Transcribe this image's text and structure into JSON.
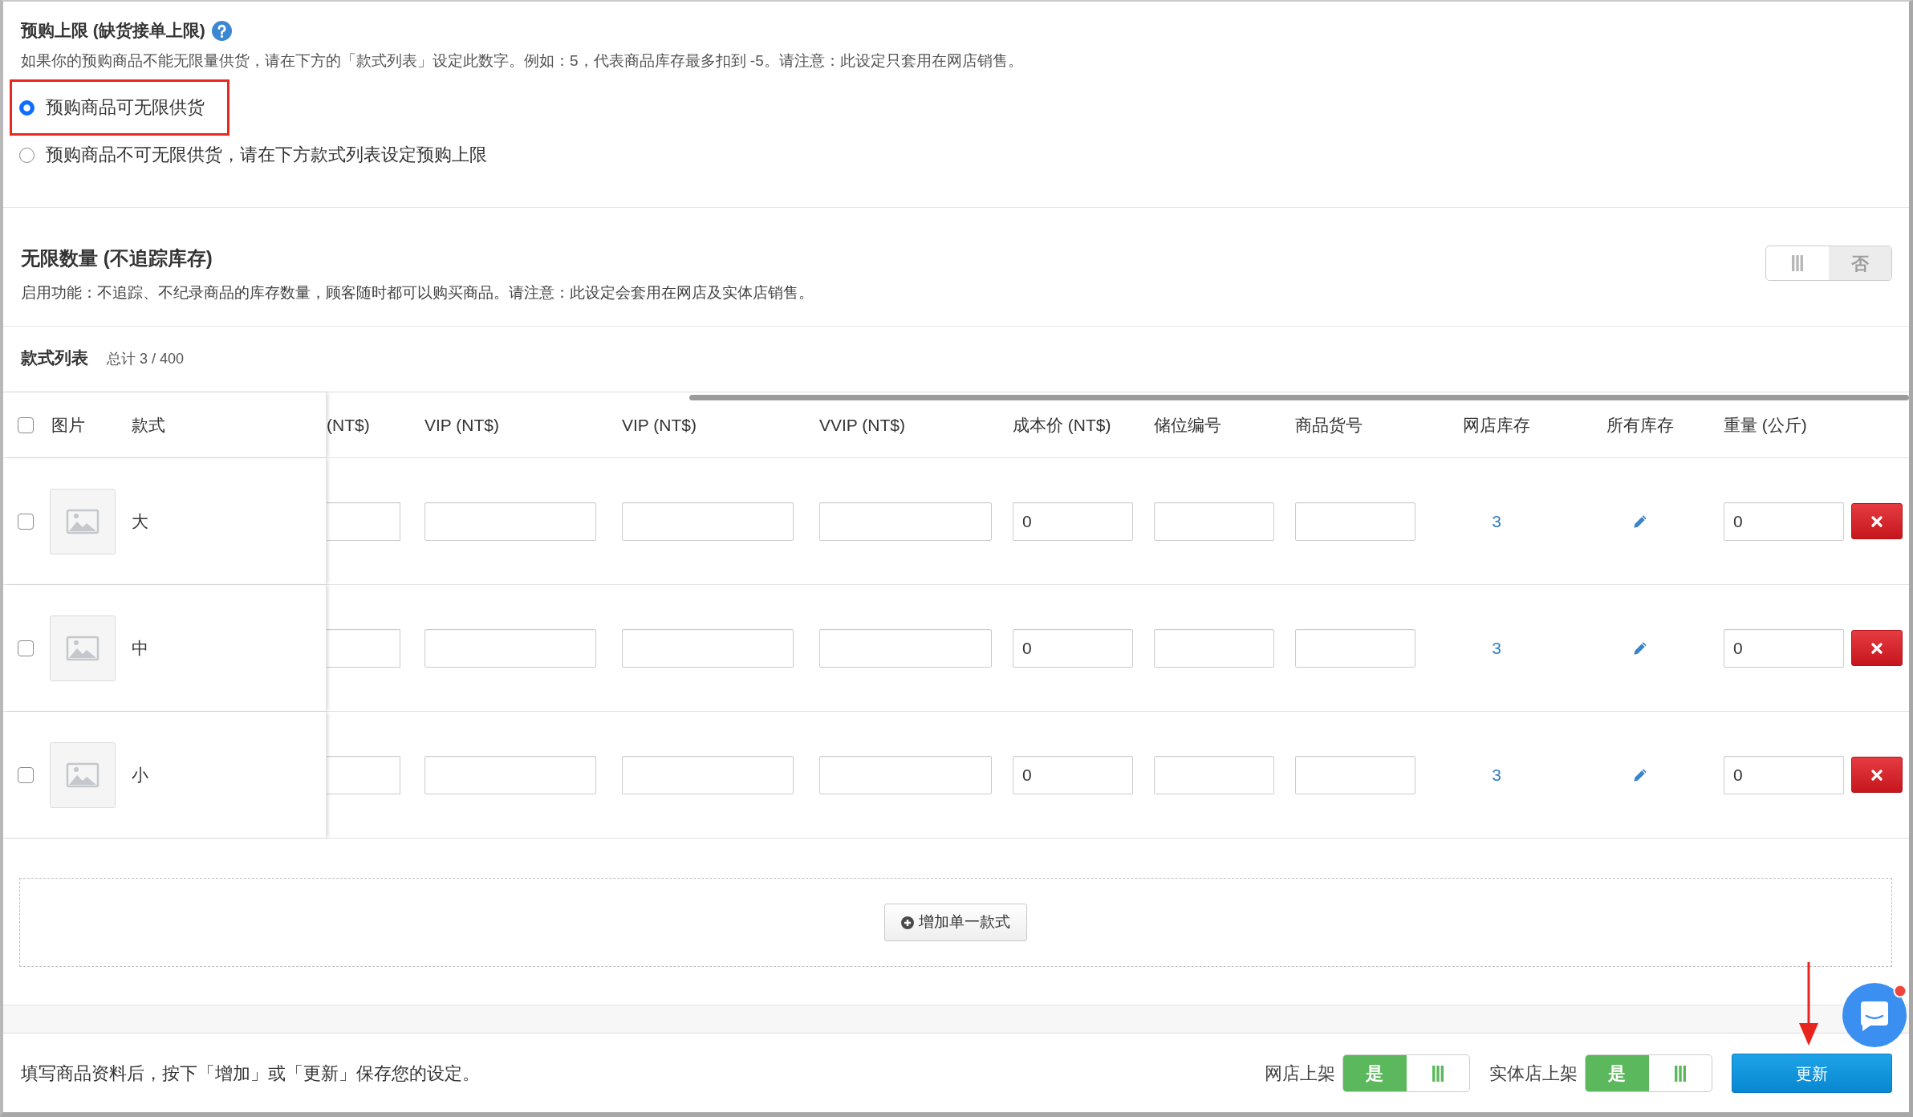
{
  "preorder_limit": {
    "title": "预购上限 (缺货接单上限)",
    "description": "如果你的预购商品不能无限量供货，请在下方的「款式列表」设定此数字。例如：5，代表商品库存最多扣到 -5。请注意：此设定只套用在网店销售。",
    "options": [
      {
        "label": "预购商品可无限供货",
        "selected": true,
        "highlighted": true
      },
      {
        "label": "预购商品不可无限供货，请在下方款式列表设定预购上限",
        "selected": false,
        "highlighted": false
      }
    ]
  },
  "unlimited_quantity": {
    "title": "无限数量 (不追踪库存)",
    "description": "启用功能：不追踪、不纪录商品的库存数量，顾客随时都可以购买商品。请注意：此设定会套用在网店及实体店销售。",
    "toggle": {
      "on": false,
      "value": "否"
    }
  },
  "variants": {
    "title": "款式列表",
    "count": "总计 3 / 400",
    "select_all": {
      "checked": false
    },
    "columns": [
      {
        "label": "图片",
        "kind": "image"
      },
      {
        "label": "款式",
        "kind": "name"
      },
      {
        "label": "(NT$)",
        "kind": "price"
      },
      {
        "label": "VIP (NT$)",
        "kind": "price"
      },
      {
        "label": "VIP (NT$)",
        "kind": "price"
      },
      {
        "label": "VVIP (NT$)",
        "kind": "price"
      },
      {
        "label": "成本价 (NT$)",
        "kind": "cost"
      },
      {
        "label": "储位编号",
        "kind": "location"
      },
      {
        "label": "商品货号",
        "kind": "sku"
      },
      {
        "label": "网店库存",
        "kind": "online_stock"
      },
      {
        "label": "所有库存",
        "kind": "all_stock"
      },
      {
        "label": "重量 (公斤)",
        "kind": "weight"
      }
    ],
    "rows": [
      {
        "checked": false,
        "name": "大",
        "cost": "0",
        "online_stock": "3",
        "weight": "0"
      },
      {
        "checked": false,
        "name": "中",
        "cost": "0",
        "online_stock": "3",
        "weight": "0"
      },
      {
        "checked": false,
        "name": "小",
        "cost": "0",
        "online_stock": "3",
        "weight": "0"
      }
    ],
    "add_button": "增加单一款式"
  },
  "footer": {
    "note": "填写商品资料后，按下「增加」或「更新」保存您的设定。",
    "switches": [
      {
        "label": "网店上架",
        "on": true,
        "value": "是"
      },
      {
        "label": "实体店上架",
        "on": true,
        "value": "是"
      }
    ],
    "update_button": {
      "label": "更新",
      "highlighted": true
    }
  }
}
